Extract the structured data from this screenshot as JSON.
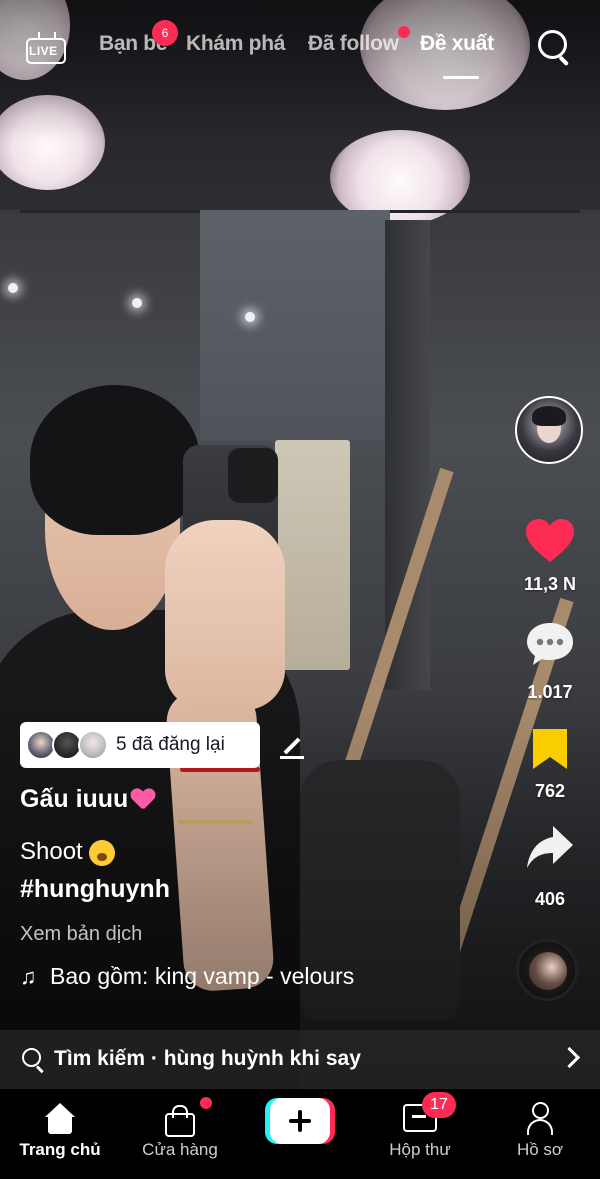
{
  "top_nav": {
    "live_label": "LIVE",
    "tabs": [
      {
        "label": "Bạn bè",
        "badge": "6"
      },
      {
        "label": "Khám phá"
      },
      {
        "label": "Đã follow",
        "has_dot": true
      },
      {
        "label": "Đề xuất",
        "active": true
      }
    ],
    "search_icon": "search-icon"
  },
  "actions": {
    "like_count": "11,3 N",
    "comment_count": "1.017",
    "save_count": "762",
    "share_count": "406"
  },
  "post": {
    "repost_label": "5 đã đăng lại",
    "username": "Gấu iuuu",
    "caption": "Shoot",
    "hashtag": "#hunghuynh",
    "translate": "Xem bản dịch",
    "music": "Bao gồm: king vamp - velours"
  },
  "search_suggestion": {
    "text": "Tìm kiếm · hùng huỳnh khi say"
  },
  "bottom_nav": {
    "items": [
      {
        "label": "Trang chủ",
        "active": true
      },
      {
        "label": "Cửa hàng",
        "has_dot": true
      },
      {
        "label": ""
      },
      {
        "label": "Hộp thư",
        "badge": "17"
      },
      {
        "label": "Hồ sơ"
      }
    ]
  },
  "colors": {
    "accent": "#fe2c55",
    "save": "#facd00",
    "cyan": "#25f4ee"
  }
}
